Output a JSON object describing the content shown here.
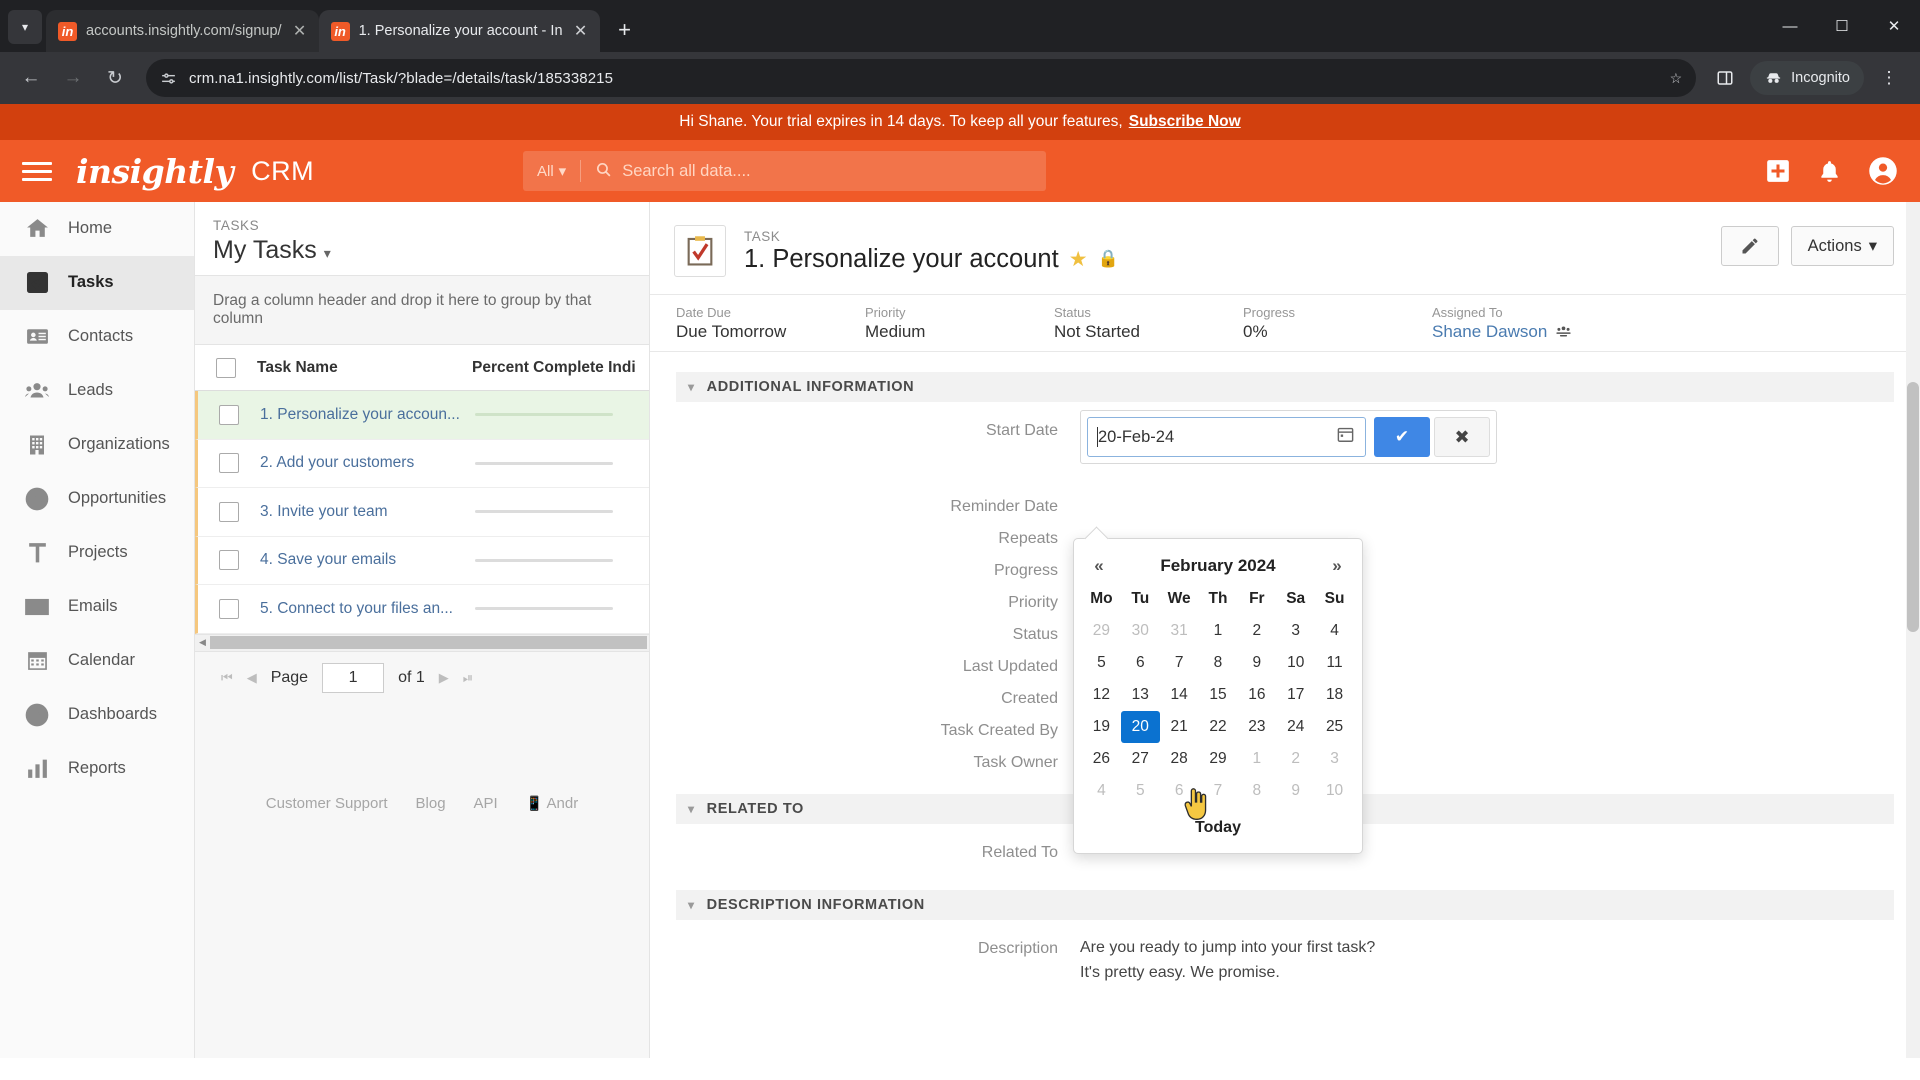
{
  "browser": {
    "tabs": [
      {
        "title": "accounts.insightly.com/signup/",
        "favicon": "in",
        "active": false
      },
      {
        "title": "1. Personalize your account - In",
        "favicon": "in",
        "active": true
      }
    ],
    "new_tab_label": "+",
    "tab_list_icon": "chevron-down-icon",
    "window_controls": {
      "minimize": "—",
      "maximize": "❐",
      "close": "✕"
    },
    "url": "crm.na1.insightly.com/list/Task/?blade=/details/task/185338215",
    "site_info_icon": "page-settings-icon",
    "back_icon": "←",
    "forward_icon": "→",
    "reload_icon": "↻",
    "bookmark_icon": "☆",
    "side_panel_icon": "side-panel-icon",
    "profile_chip": "Incognito",
    "menu_icon": "⋮"
  },
  "trial_banner": {
    "message": "Hi Shane. Your trial expires in 14 days. To keep all your features,",
    "cta": "Subscribe Now"
  },
  "app_header": {
    "logo": "insightly",
    "product": "CRM",
    "search_scope": "All",
    "search_placeholder": "Search all data....",
    "add_icon": "plus-square-icon",
    "bell_icon": "notifications-icon",
    "account_icon": "account-circle-icon"
  },
  "sidebar": {
    "items": [
      {
        "label": "Home",
        "icon": "home-icon",
        "active": false
      },
      {
        "label": "Tasks",
        "icon": "checkbox-check-icon",
        "active": true
      },
      {
        "label": "Contacts",
        "icon": "contact-card-icon",
        "active": false
      },
      {
        "label": "Leads",
        "icon": "people-icon",
        "active": false
      },
      {
        "label": "Organizations",
        "icon": "building-icon",
        "active": false
      },
      {
        "label": "Opportunities",
        "icon": "target-icon",
        "active": false
      },
      {
        "label": "Projects",
        "icon": "hammer-icon",
        "active": false
      },
      {
        "label": "Emails",
        "icon": "envelope-icon",
        "active": false
      },
      {
        "label": "Calendar",
        "icon": "calendar-icon",
        "active": false
      },
      {
        "label": "Dashboards",
        "icon": "gauge-icon",
        "active": false
      },
      {
        "label": "Reports",
        "icon": "bar-chart-icon",
        "active": false
      }
    ]
  },
  "list_pane": {
    "eyebrow": "TASKS",
    "title": "My Tasks",
    "title_caret": "▾",
    "group_hint": "Drag a column header and drop it here to group by that column",
    "columns": [
      "Task Name",
      "Percent Complete Indi"
    ],
    "rows": [
      {
        "name": "1. Personalize your accoun...",
        "selected": true
      },
      {
        "name": "2. Add your customers",
        "selected": false
      },
      {
        "name": "3. Invite your team",
        "selected": false
      },
      {
        "name": "4. Save your emails",
        "selected": false
      },
      {
        "name": "5. Connect to your files an...",
        "selected": false
      }
    ],
    "pager": {
      "first_icon": "⏮",
      "prev_icon": "◀",
      "page_label": "Page",
      "page_value": "1",
      "of_label": "of 1",
      "next_icon": "▶",
      "last_icon": "⏭"
    },
    "footer_links": [
      "Customer Support",
      "Blog",
      "API"
    ],
    "footer_android": "Andr"
  },
  "detail": {
    "eyebrow": "TASK",
    "title": "1. Personalize your account",
    "star_icon": "star-filled-icon",
    "lock_icon": "lock-icon",
    "edit_icon": "pencil-icon",
    "actions_label": "Actions",
    "actions_caret": "▾",
    "summary": [
      {
        "label": "Date Due",
        "value": "Due Tomorrow",
        "link": false
      },
      {
        "label": "Priority",
        "value": "Medium",
        "link": false
      },
      {
        "label": "Status",
        "value": "Not Started",
        "link": false
      },
      {
        "label": "Progress",
        "value": "0%",
        "link": false
      },
      {
        "label": "Assigned To",
        "value": "Shane Dawson",
        "link": true
      }
    ],
    "sections": {
      "additional": {
        "title": "ADDITIONAL INFORMATION",
        "fields": [
          "Start Date",
          "Reminder Date",
          "Repeats",
          "Progress",
          "Priority",
          "Status",
          "Last Updated",
          "Created",
          "Task Created By",
          "Task Owner"
        ]
      },
      "related": {
        "title": "RELATED TO",
        "fields": [
          "Related To"
        ]
      },
      "description": {
        "title": "DESCRIPTION INFORMATION",
        "label": "Description",
        "line1": "Are you ready to jump into your first task?",
        "line2": "It's pretty easy. We promise."
      }
    },
    "date_editor": {
      "value": "20-Feb-24",
      "calendar_icon": "calendar-icon",
      "confirm_icon": "✔",
      "cancel_icon": "✖"
    },
    "datepicker": {
      "prev": "«",
      "next": "»",
      "month_label": "February 2024",
      "weekdays": [
        "Mo",
        "Tu",
        "We",
        "Th",
        "Fr",
        "Sa",
        "Su"
      ],
      "weeks": [
        [
          {
            "d": "29",
            "mute": true
          },
          {
            "d": "30",
            "mute": true
          },
          {
            "d": "31",
            "mute": true
          },
          {
            "d": "1"
          },
          {
            "d": "2"
          },
          {
            "d": "3"
          },
          {
            "d": "4"
          }
        ],
        [
          {
            "d": "5"
          },
          {
            "d": "6"
          },
          {
            "d": "7"
          },
          {
            "d": "8"
          },
          {
            "d": "9"
          },
          {
            "d": "10"
          },
          {
            "d": "11"
          }
        ],
        [
          {
            "d": "12"
          },
          {
            "d": "13"
          },
          {
            "d": "14"
          },
          {
            "d": "15"
          },
          {
            "d": "16"
          },
          {
            "d": "17"
          },
          {
            "d": "18"
          }
        ],
        [
          {
            "d": "19"
          },
          {
            "d": "20",
            "active": true
          },
          {
            "d": "21"
          },
          {
            "d": "22"
          },
          {
            "d": "23"
          },
          {
            "d": "24"
          },
          {
            "d": "25"
          }
        ],
        [
          {
            "d": "26"
          },
          {
            "d": "27"
          },
          {
            "d": "28"
          },
          {
            "d": "29"
          },
          {
            "d": "1",
            "mute": true
          },
          {
            "d": "2",
            "mute": true
          },
          {
            "d": "3",
            "mute": true
          }
        ],
        [
          {
            "d": "4",
            "mute": true
          },
          {
            "d": "5",
            "mute": true
          },
          {
            "d": "6",
            "mute": true
          },
          {
            "d": "7",
            "mute": true
          },
          {
            "d": "8",
            "mute": true
          },
          {
            "d": "9",
            "mute": true
          },
          {
            "d": "10",
            "mute": true
          }
        ]
      ],
      "today_label": "Today",
      "selected_day": "20",
      "accent_color": "#0b72d0"
    }
  },
  "colors": {
    "brand_orange": "#f05a28",
    "banner_orange": "#d2400e",
    "link_blue": "#4a6f9c",
    "selected_row_green": "#e9f5e5",
    "accent_blue": "#3f87e5"
  }
}
